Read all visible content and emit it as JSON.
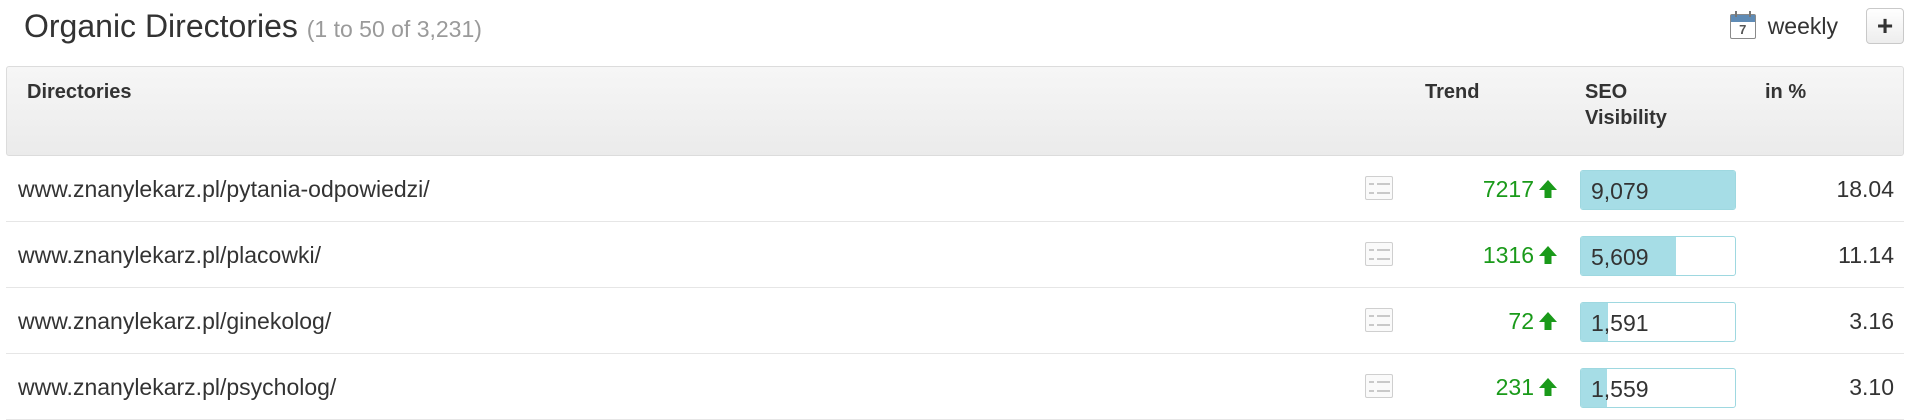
{
  "header": {
    "title": "Organic Directories",
    "count": "(1 to 50 of 3,231)",
    "calendar_day": "7",
    "interval_label": "weekly",
    "add_label": "+"
  },
  "columns": {
    "directories": "Directories",
    "trend": "Trend",
    "seo_visibility_line1": "SEO",
    "seo_visibility_line2": "Visibility",
    "percent": "in %"
  },
  "rows": [
    {
      "url": "www.znanylekarz.pl/pytania-odpowiedzi/",
      "trend": "7217",
      "trend_direction": "up",
      "visibility": "9,079",
      "visibility_value": 9079,
      "percent": "18.04"
    },
    {
      "url": "www.znanylekarz.pl/placowki/",
      "trend": "1316",
      "trend_direction": "up",
      "visibility": "5,609",
      "visibility_value": 5609,
      "percent": "11.14"
    },
    {
      "url": "www.znanylekarz.pl/ginekolog/",
      "trend": "72",
      "trend_direction": "up",
      "visibility": "1,591",
      "visibility_value": 1591,
      "percent": "3.16"
    },
    {
      "url": "www.znanylekarz.pl/psycholog/",
      "trend": "231",
      "trend_direction": "up",
      "visibility": "1,559",
      "visibility_value": 1559,
      "percent": "3.10"
    }
  ],
  "colors": {
    "trend_up": "#1a9a1a",
    "bar_fill": "#a6dde6",
    "bar_border": "#9ed8e0"
  }
}
